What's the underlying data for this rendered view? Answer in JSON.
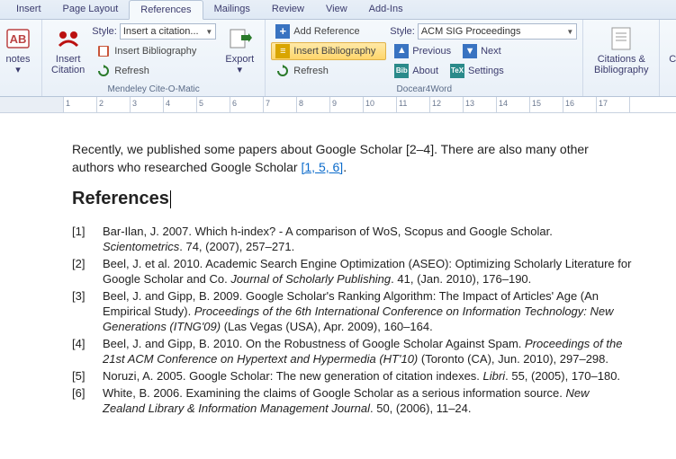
{
  "tabs": [
    "Insert",
    "Page Layout",
    "References",
    "Mailings",
    "Review",
    "View",
    "Add-Ins"
  ],
  "active_tab": 2,
  "mendeley": {
    "title": "Mendeley Cite-O-Matic",
    "insert_citation": "Insert\nCitation",
    "style_label": "Style:",
    "style_value": "Insert a citation...",
    "insert_bib": "Insert Bibliography",
    "refresh": "Refresh",
    "export": "Export"
  },
  "docear": {
    "title": "Docear4Word",
    "add_ref": "Add Reference",
    "insert_bib": "Insert Bibliography",
    "refresh": "Refresh",
    "style_label": "Style:",
    "style_value": "ACM SIG Proceedings",
    "previous": "Previous",
    "next": "Next",
    "about": "About",
    "settings": "Settings"
  },
  "right": {
    "citbib": "Citations &\nBibliography",
    "caption": "Caption"
  },
  "doc": {
    "p1a": "Recently, we published some papers about Google Scholar [2–4]. There are also many other authors who researched Google Scholar ",
    "p1link": "[1, 5, 6]",
    "p1b": ".",
    "heading": "References",
    "refs": [
      {
        "n": "[1]",
        "t": "Bar-Ilan, J. 2007.  Which h-index? - A comparison of WoS, Scopus and Google Scholar. ",
        "i": "Scientometrics",
        "r": ". 74, (2007), 257–271."
      },
      {
        "n": "[2]",
        "t": "Beel, J. et al. 2010.  Academic Search Engine Optimization (ASEO): Optimizing Scholarly Literature for Google Scholar and Co. ",
        "i": "Journal of Scholarly Publishing",
        "r": ". 41, (Jan. 2010), 176–190."
      },
      {
        "n": "[3]",
        "t": "Beel, J. and Gipp, B. 2009.  Google Scholar's Ranking Algorithm: The Impact of Articles' Age (An Empirical Study). ",
        "i": "Proceedings of the 6th International Conference on Information Technology: New Generations (ITNG'09)",
        "r": " (Las Vegas (USA), Apr. 2009), 160–164."
      },
      {
        "n": "[4]",
        "t": "Beel, J. and Gipp, B. 2010.  On the Robustness of Google Scholar Against Spam. ",
        "i": "Proceedings of the 21st ACM Conference on Hypertext and Hypermedia (HT'10)",
        "r": " (Toronto (CA), Jun. 2010), 297–298."
      },
      {
        "n": "[5]",
        "t": "Noruzi, A. 2005.  Google Scholar: The new generation of citation indexes. ",
        "i": "Libri",
        "r": ". 55, (2005), 170–180."
      },
      {
        "n": "[6]",
        "t": "White, B. 2006.  Examining the claims of Google Scholar as a serious information source. ",
        "i": "New Zealand Library & Information Management Journal",
        "r": ". 50, (2006), 11–24."
      }
    ]
  },
  "ruler_marks": [
    1,
    2,
    3,
    4,
    5,
    6,
    7,
    8,
    9,
    10,
    11,
    12,
    13,
    14,
    15,
    16,
    17
  ]
}
